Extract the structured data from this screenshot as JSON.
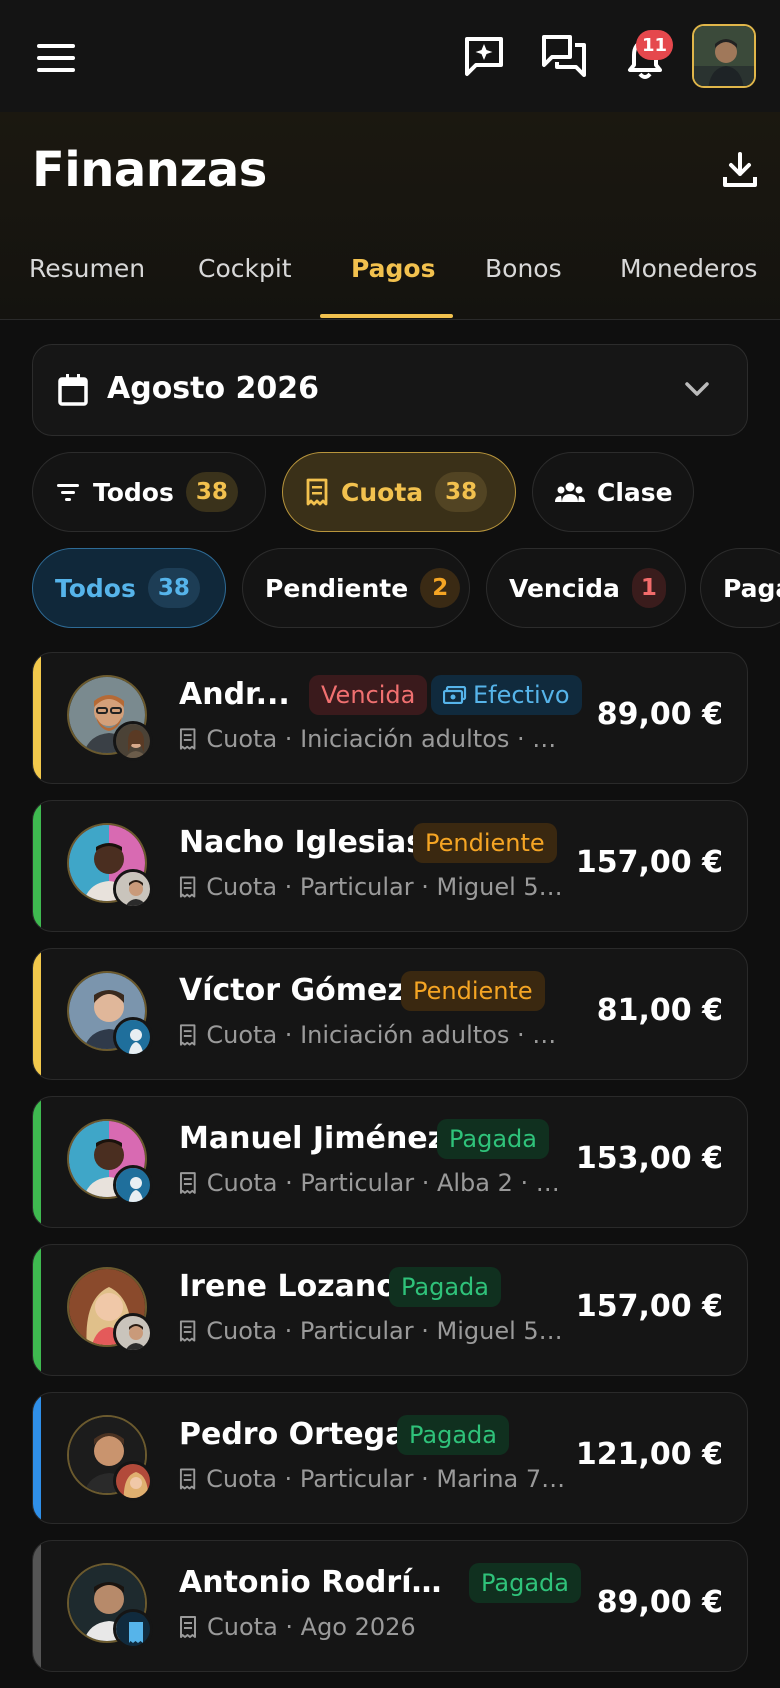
{
  "topbar": {
    "notifications_count": "11",
    "icons": [
      "menu-icon",
      "ai-chat-icon",
      "messages-icon",
      "bell-icon"
    ]
  },
  "header": {
    "title": "Finanzas",
    "tabs": [
      {
        "label": "Resumen",
        "active": false
      },
      {
        "label": "Cockpit",
        "active": false
      },
      {
        "label": "Pagos",
        "active": true
      },
      {
        "label": "Bonos",
        "active": false
      },
      {
        "label": "Monederos",
        "active": false
      }
    ]
  },
  "month_picker": {
    "label": "Agosto 2026"
  },
  "type_filters": [
    {
      "label": "Todos",
      "count": "38",
      "selected": false
    },
    {
      "label": "Cuota",
      "count": "38",
      "selected": true
    },
    {
      "label": "Clase",
      "count": "",
      "selected": false
    }
  ],
  "status_filters": [
    {
      "label": "Todos",
      "count": "38",
      "selected": true
    },
    {
      "label": "Pendiente",
      "count": "2",
      "selected": false
    },
    {
      "label": "Vencida",
      "count": "1",
      "selected": false
    },
    {
      "label": "Paga",
      "count": "",
      "selected": false
    }
  ],
  "payments": [
    {
      "name": "Andr...",
      "status": "Vencida",
      "method": "Efectivo",
      "meta": "Cuota · Iniciación adultos · Gr...",
      "amount": "89,00 €",
      "stripe": "#f2c94c"
    },
    {
      "name": "Nacho Iglesias",
      "status": "Pendiente",
      "method": "",
      "meta": "Cuota · Particular · Miguel 5 · ...",
      "amount": "157,00 €",
      "stripe": "#3fb950"
    },
    {
      "name": "Víctor Gómez",
      "status": "Pendiente",
      "method": "",
      "meta": "Cuota · Iniciación adultos · Gr...",
      "amount": "81,00 €",
      "stripe": "#f2c94c"
    },
    {
      "name": "Manuel Jiménez",
      "status": "Pagada",
      "method": "",
      "meta": "Cuota · Particular · Alba 2 · A...",
      "amount": "153,00 €",
      "stripe": "#3fb950"
    },
    {
      "name": "Irene Lozano",
      "status": "Pagada",
      "method": "",
      "meta": "Cuota · Particular · Miguel 5 · ...",
      "amount": "157,00 €",
      "stripe": "#3fb950"
    },
    {
      "name": "Pedro Ortega",
      "status": "Pagada",
      "method": "",
      "meta": "Cuota · Particular · Marina 7 · ...",
      "amount": "121,00 €",
      "stripe": "#2f8fe8"
    },
    {
      "name": "Antonio Rodrígu...",
      "status": "Pagada",
      "method": "",
      "meta": "Cuota · Ago 2026",
      "amount": "89,00 €",
      "stripe": "#555555"
    }
  ],
  "colors": {
    "accent": "#f2c14e",
    "background": "#0f0f0f",
    "card": "#151515"
  }
}
